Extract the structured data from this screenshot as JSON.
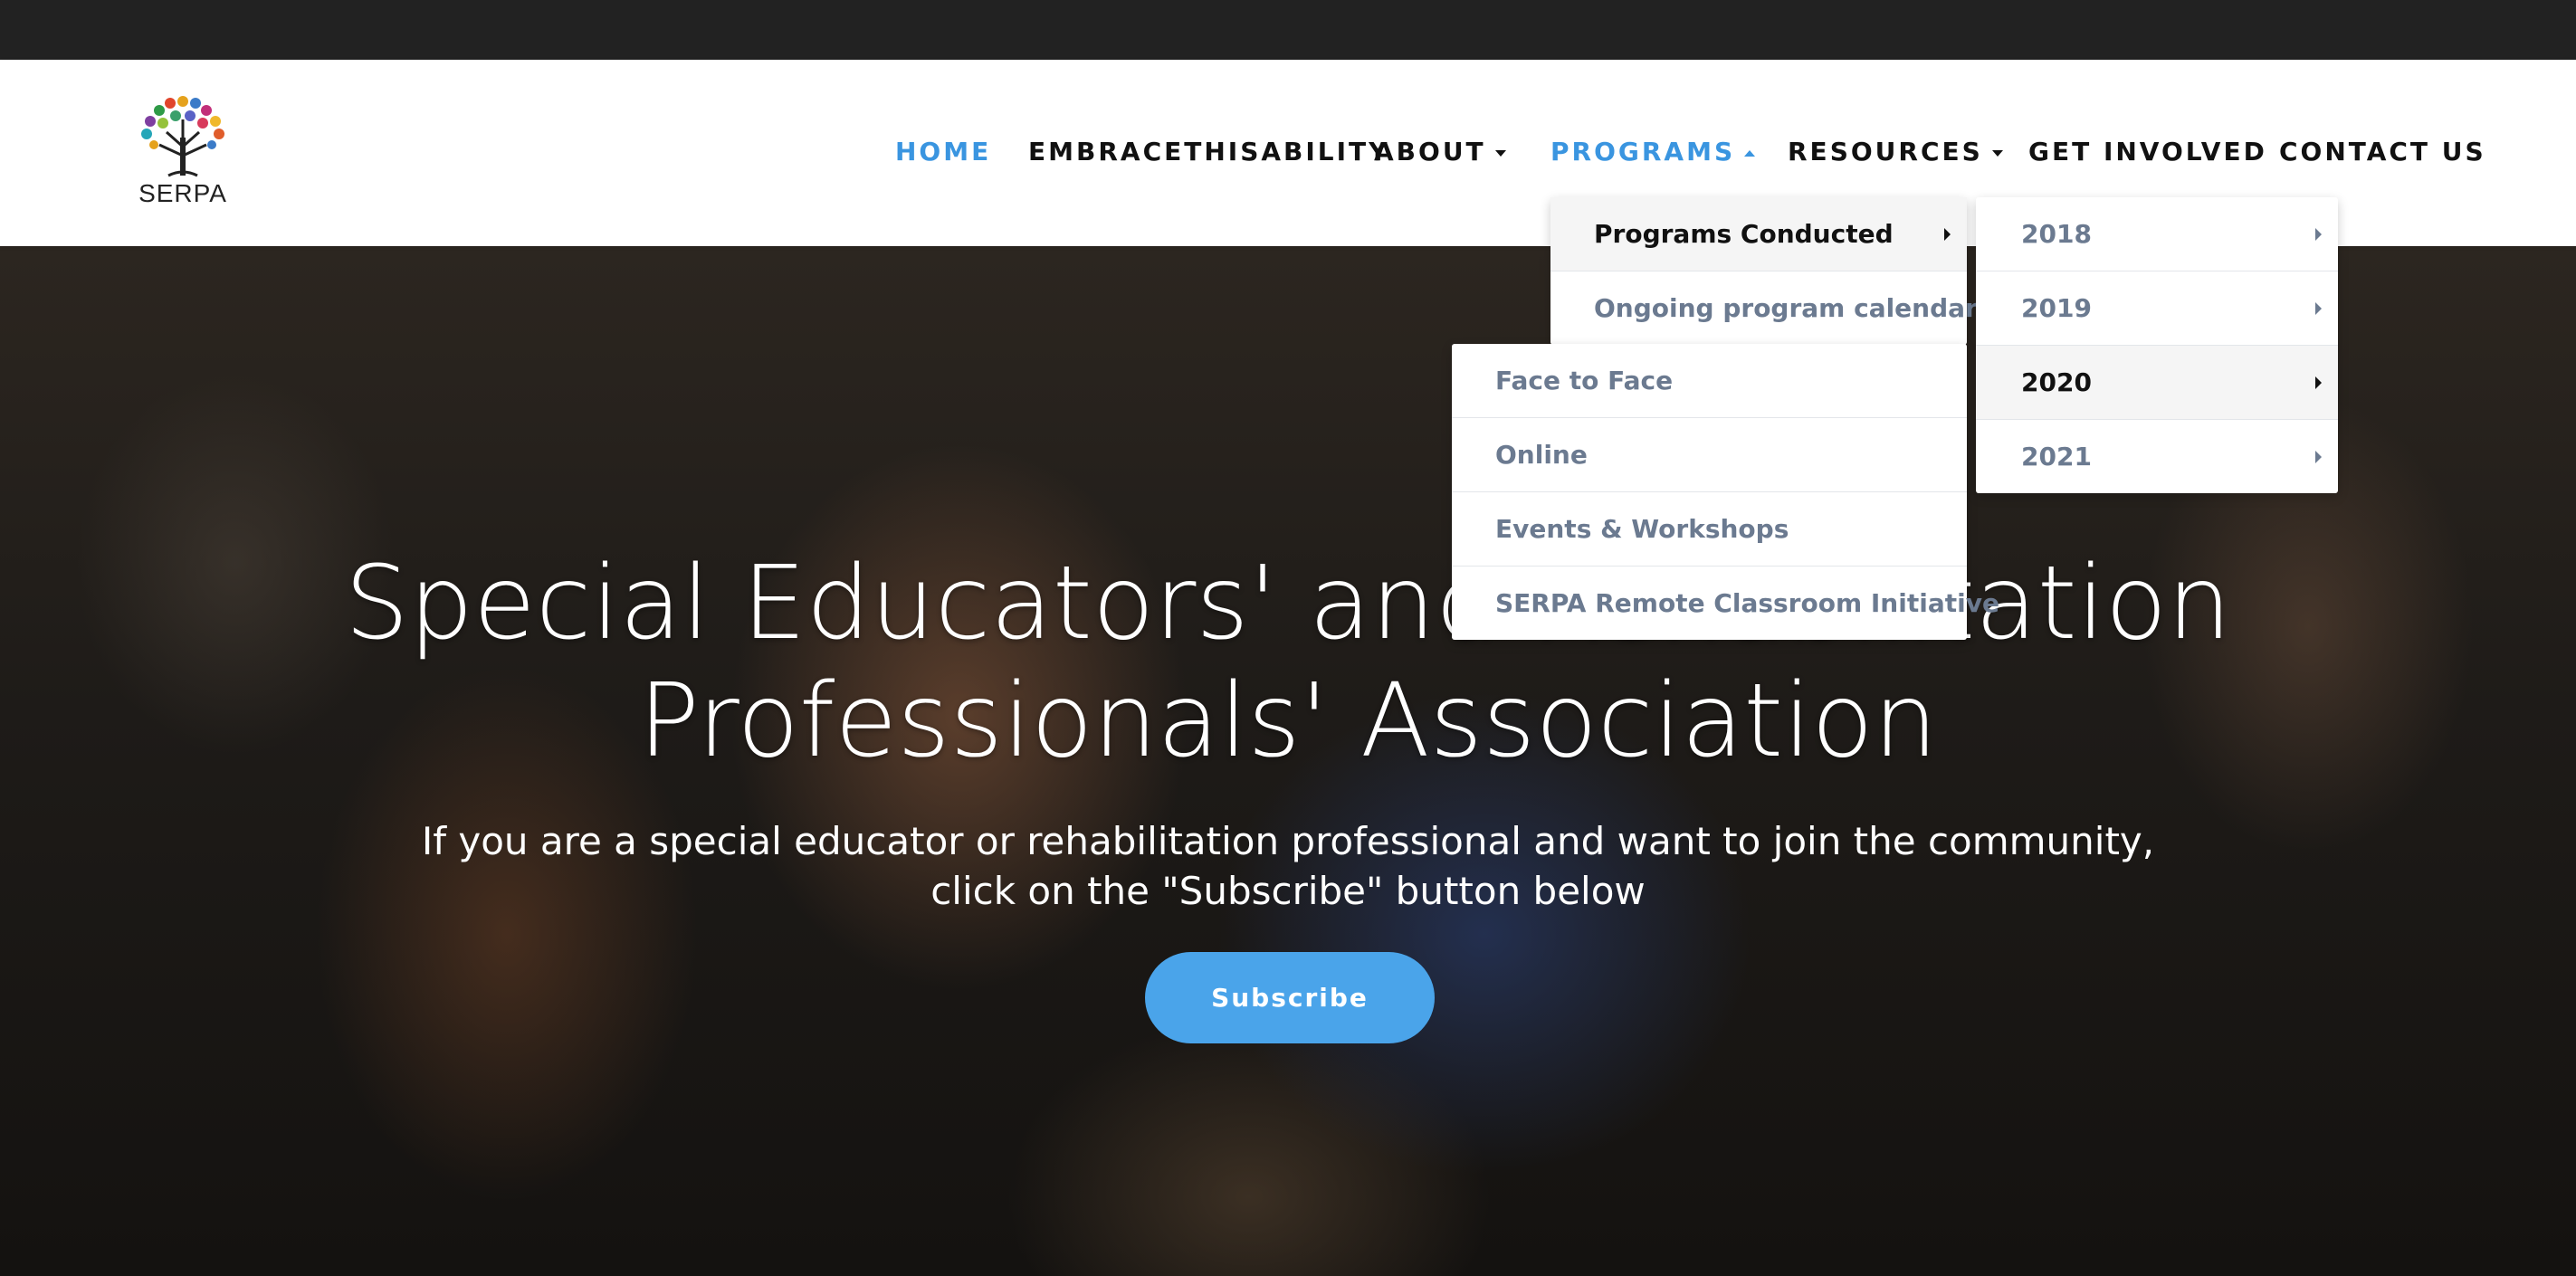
{
  "brand": {
    "logo_text": "SERPA"
  },
  "nav": {
    "home": "HOME",
    "embrace": "EMBRACETHISABILITY",
    "about": "ABOUT",
    "programs": "PROGRAMS",
    "resources": "RESOURCES",
    "get_involved": "GET INVOLVED",
    "contact": "CONTACT US",
    "active": "HOME",
    "expanded": "PROGRAMS"
  },
  "programs_menu": {
    "items": [
      "Programs Conducted",
      "Ongoing program calendar"
    ],
    "highlighted": "Programs Conducted"
  },
  "years_menu": {
    "items": [
      "2018",
      "2019",
      "2020",
      "2021"
    ],
    "highlighted": "2020"
  },
  "year_2020_menu": {
    "items": [
      "Face to Face",
      "Online",
      "Events & Workshops",
      "SERPA Remote Classroom Initiative"
    ]
  },
  "hero": {
    "title": "Special Educators' and Rehabilitation Professionals' Association",
    "subtitle": "If you are a special educator or rehabilitation professional and want to join the community, click on the \"Subscribe\" button below",
    "button": "Subscribe"
  },
  "colors": {
    "accent": "#3a95e0",
    "button": "#4aa4ea",
    "menu_text": "#6b7a90",
    "top_strip": "#222222"
  },
  "icons": [
    "serpa-tree-logo-icon",
    "caret-down-icon",
    "caret-up-icon",
    "submenu-arrow-icon"
  ]
}
